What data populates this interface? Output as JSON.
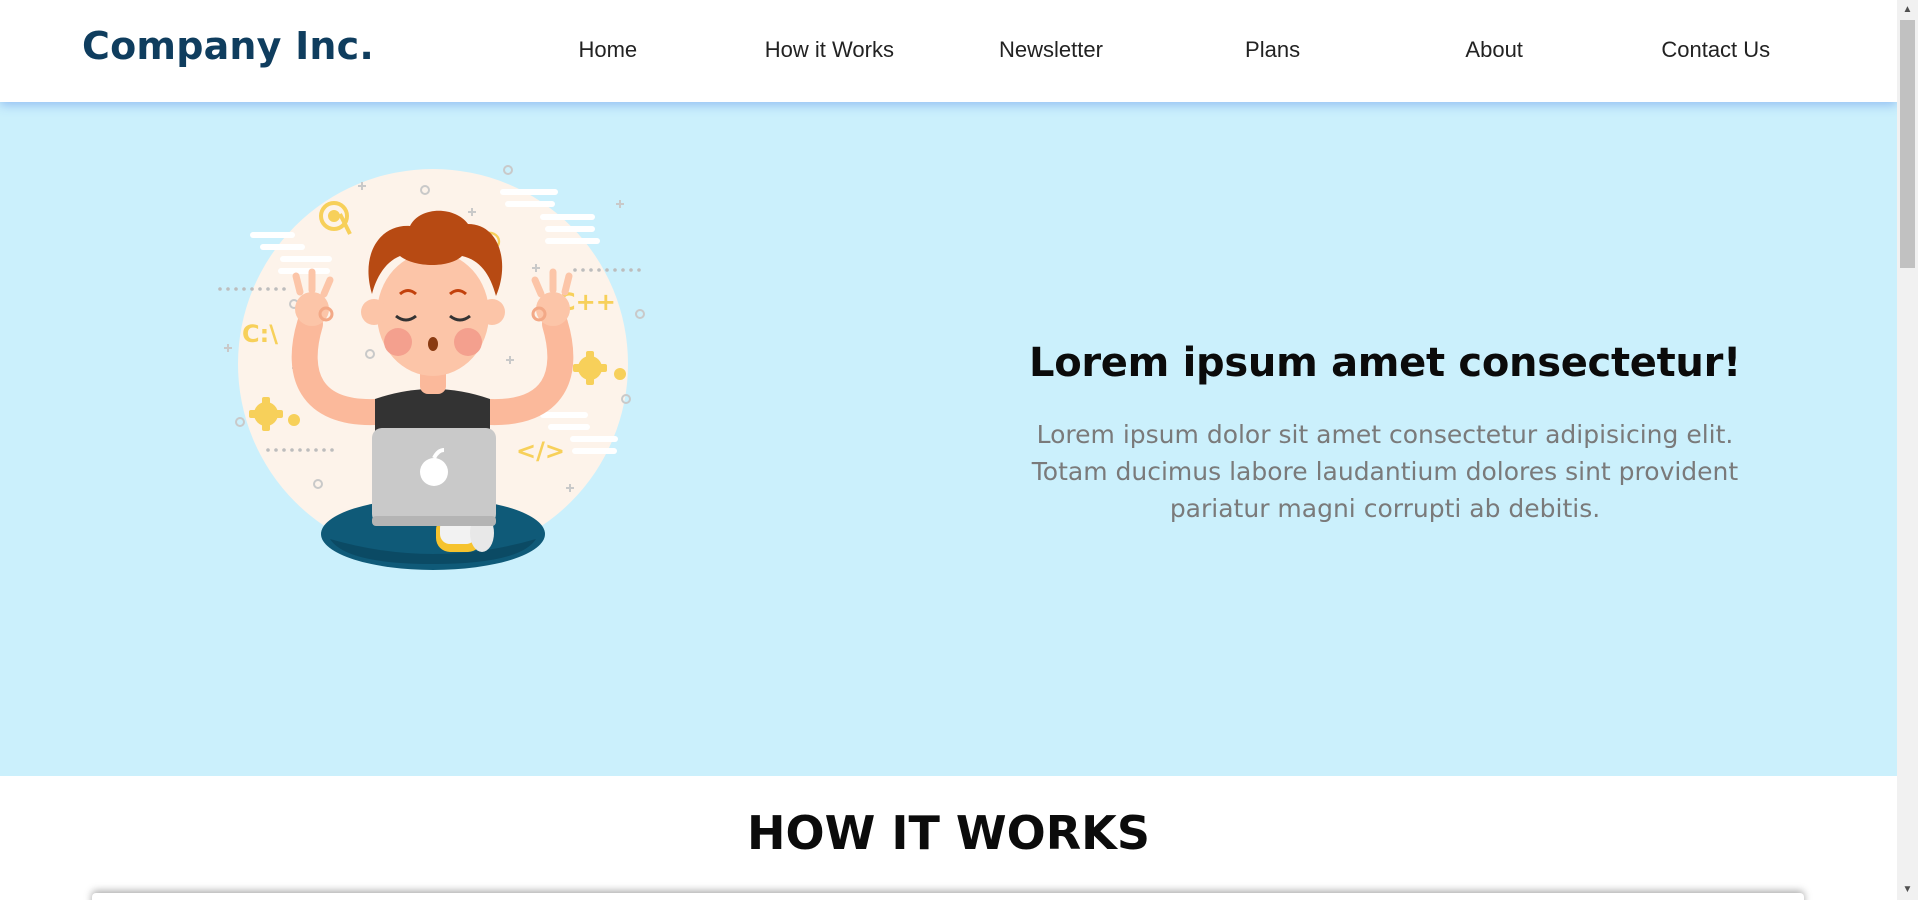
{
  "header": {
    "logo": "Company Inc.",
    "nav": [
      "Home",
      "How it Works",
      "Newsletter",
      "Plans",
      "About",
      "Contact Us"
    ]
  },
  "hero": {
    "title": "Lorem ipsum amet consectetur!",
    "subtitle_lines": [
      "Lorem ipsum dolor sit amet consectetur adipisicing elit.",
      "Totam ducimus labore laudantium dolores sint provident",
      "pariatur magni corrupti ab debitis."
    ],
    "illustration_text": [
      "C:\\",
      "C++",
      "</>",
      "@"
    ]
  },
  "how_it_works": {
    "title": "HOW IT WORKS"
  },
  "scrollbar": {
    "up_arrow": "▲",
    "down_arrow": "▼"
  },
  "colors": {
    "logo": "#0f3d5e",
    "hero_bg": "#cbf0fc",
    "subtitle": "#7a7a7a",
    "accent_yellow": "#f7d05a"
  }
}
